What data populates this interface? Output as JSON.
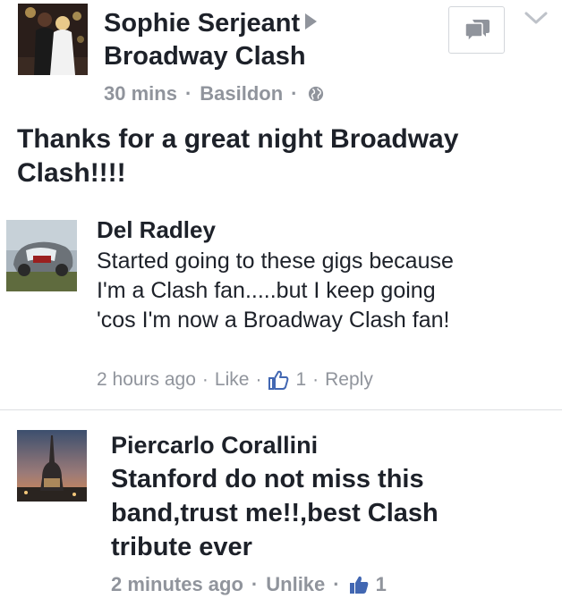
{
  "post": {
    "author": "Sophie Serjeant",
    "target": "Broadway Clash",
    "time": "30 mins",
    "location": "Basildon",
    "separator": "·",
    "privacy_icon": "globe-icon",
    "text": "Thanks for a great night Broadway Clash!!!!"
  },
  "header_actions": {
    "messenger_icon": "messenger-icon",
    "menu_icon": "chevron-down-icon"
  },
  "comments": [
    {
      "author": "Del Radley",
      "text": "Started going to these gigs because I'm a Clash fan.....but I keep going 'cos I'm now a Broadway Clash fan!",
      "time": "2 hours ago",
      "like_label": "Like",
      "like_count": "1",
      "reply_label": "Reply"
    },
    {
      "author": "Piercarlo Corallini",
      "text": "Stanford do not miss this band,trust me!!,best Clash tribute ever",
      "time": "2 minutes ago",
      "like_label": "Unlike",
      "like_count": "1"
    }
  ],
  "colors": {
    "text": "#1d2129",
    "meta": "#90949c",
    "like_blue": "#4267b2",
    "divider": "#dddfe2"
  }
}
